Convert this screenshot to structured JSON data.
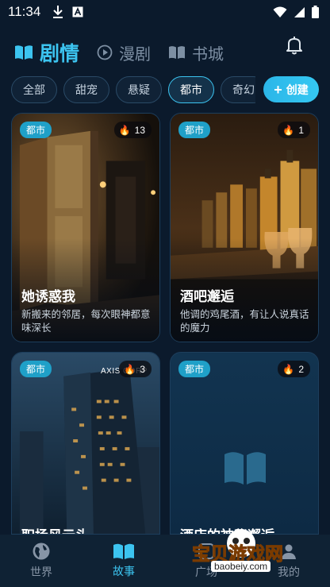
{
  "status_bar": {
    "time": "11:34"
  },
  "header": {
    "tabs": [
      {
        "label": "剧情",
        "icon": "open-book-icon",
        "active": true
      },
      {
        "label": "漫剧",
        "icon": "play-circle-icon",
        "active": false
      },
      {
        "label": "书城",
        "icon": "book-icon",
        "active": false
      }
    ],
    "notification_icon": "bell-icon"
  },
  "categories": {
    "items": [
      "全部",
      "甜宠",
      "悬疑",
      "都市",
      "奇幻"
    ],
    "selected": "都市",
    "create_label": "创建"
  },
  "cards": [
    {
      "tag": "都市",
      "heat": "13",
      "title": "她诱惑我",
      "desc": "新搬来的邻居，每次眼神都意味深长"
    },
    {
      "tag": "都市",
      "heat": "1",
      "title": "酒吧邂逅",
      "desc": "他调的鸡尾酒，有让人说真话的魔力"
    },
    {
      "tag": "都市",
      "heat": "3",
      "title": "职场风云头",
      "sign": "AXIS CORP"
    },
    {
      "tag": "都市",
      "heat": "2",
      "title": "酒店的神秘邂逅"
    }
  ],
  "bottom_nav": {
    "items": [
      {
        "label": "世界",
        "icon": "globe-icon",
        "active": false
      },
      {
        "label": "故事",
        "icon": "open-book-icon",
        "active": true
      },
      {
        "label": "广场",
        "icon": "square-icon",
        "active": false
      },
      {
        "label": "我的",
        "icon": "user-icon",
        "active": false
      }
    ]
  },
  "watermark": {
    "text": "宝贝游戏网",
    "url": "baobeiy.com"
  },
  "colors": {
    "accent": "#3cc4f0",
    "background": "#0b1a2c",
    "tag": "#1fa0c8"
  }
}
